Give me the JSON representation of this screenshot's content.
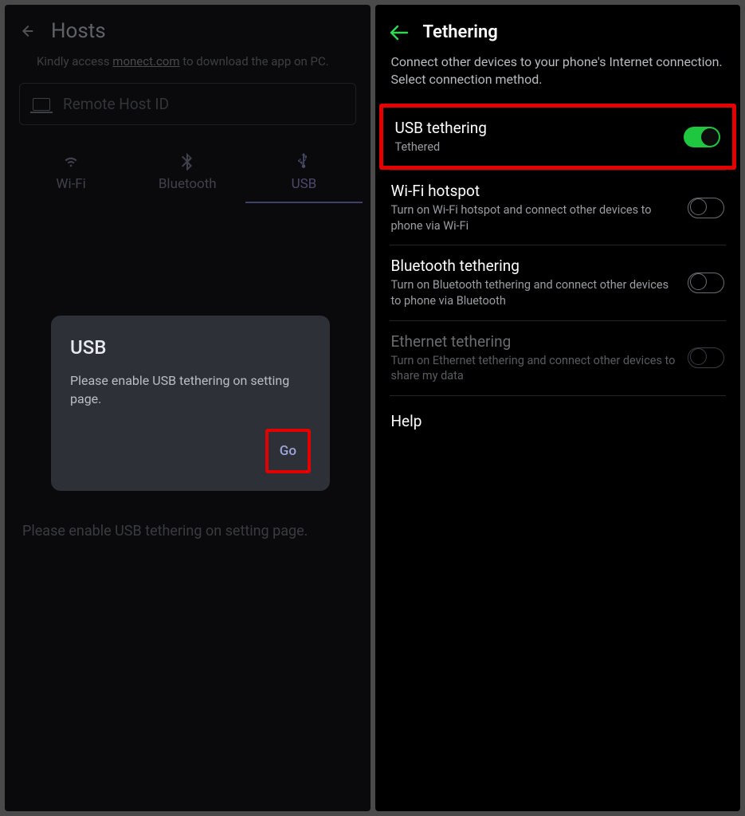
{
  "left": {
    "title": "Hosts",
    "subtitle_prefix": "Kindly access ",
    "subtitle_link": "monect.com",
    "subtitle_suffix": " to download the app on PC.",
    "input_placeholder": "Remote Host ID",
    "tabs": [
      {
        "label": "Wi-Fi",
        "icon": "wifi"
      },
      {
        "label": "Bluetooth",
        "icon": "bluetooth"
      },
      {
        "label": "USB",
        "icon": "usb",
        "active": true
      }
    ],
    "dialog": {
      "title": "USB",
      "body": "Please enable USB tethering on setting page.",
      "action_label": "Go"
    },
    "bottom_text": "Please enable USB tethering on setting page."
  },
  "right": {
    "title": "Tethering",
    "description": "Connect other devices to your phone's Internet connection. Select connection method.",
    "items": [
      {
        "title": "USB tethering",
        "subtitle": "Tethered",
        "toggle": "on",
        "highlighted": true
      },
      {
        "title": "Wi-Fi hotspot",
        "subtitle": "Turn on Wi-Fi hotspot and connect other devices to phone via Wi-Fi",
        "toggle": "off"
      },
      {
        "title": "Bluetooth tethering",
        "subtitle": "Turn on Bluetooth tethering and connect other devices to phone via Bluetooth",
        "toggle": "off"
      },
      {
        "title": "Ethernet tethering",
        "subtitle": "Turn on Ethernet tethering and connect other devices to share my data",
        "toggle": "off",
        "disabled": true
      }
    ],
    "help_label": "Help"
  },
  "colors": {
    "accent_green": "#1fc740",
    "highlight_red": "#e50000"
  }
}
